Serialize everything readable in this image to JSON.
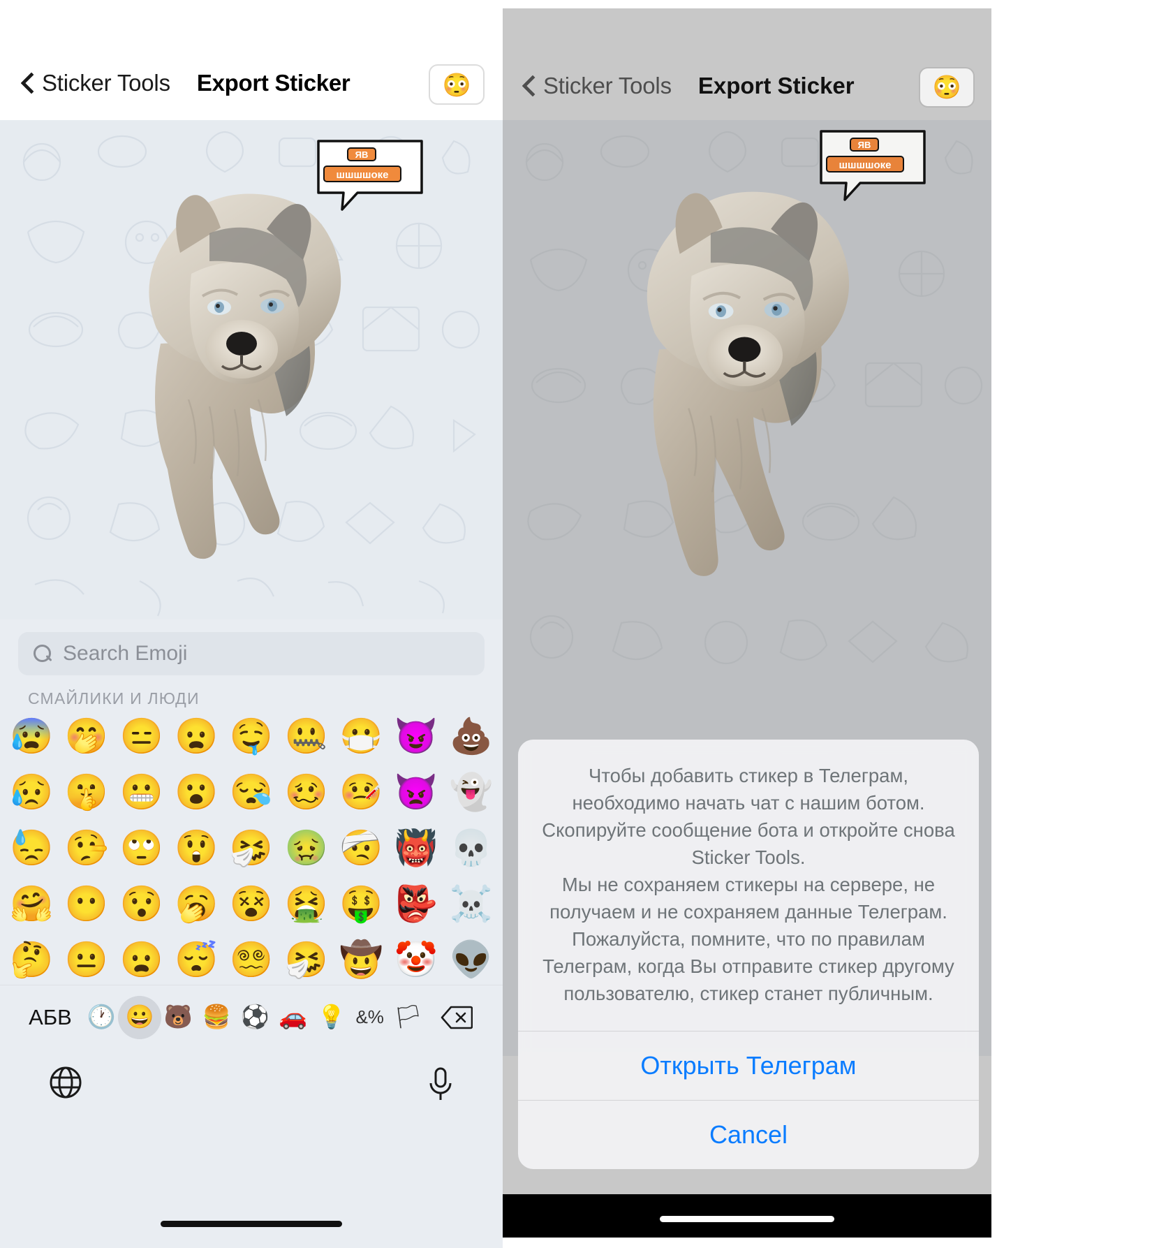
{
  "left": {
    "nav": {
      "back_label": "Sticker Tools",
      "title": "Export Sticker",
      "badge_emoji": "😳"
    },
    "sticker": {
      "bubble_line1": "ЯВ",
      "bubble_line2": "шшшшоке"
    },
    "keyboard": {
      "search_placeholder": "Search Emoji",
      "category_title": "СМАЙЛИКИ И ЛЮДИ",
      "rows": [
        [
          "😰",
          "🤭",
          "😑",
          "😦",
          "🤤",
          "🤐",
          "😷",
          "😈",
          "💩"
        ],
        [
          "😥",
          "🤫",
          "😬",
          "😮",
          "😪",
          "🥴",
          "🤒",
          "👿",
          "👻"
        ],
        [
          "😓",
          "🤥",
          "🙄",
          "😲",
          "🤧",
          "🤢",
          "🤕",
          "👹",
          "💀"
        ],
        [
          "🤗",
          "😶",
          "😯",
          "🥱",
          "😵",
          "🤮",
          "🤑",
          "👺",
          "☠️"
        ],
        [
          "🤔",
          "😐",
          "😦",
          "😴",
          "😵‍💫",
          "🤧",
          "🤠",
          "🤡",
          "👽"
        ]
      ],
      "toolbar": {
        "abc_label": "АБВ",
        "icons": [
          {
            "name": "recent-clock-icon",
            "glyph": "🕐"
          },
          {
            "name": "smileys-people-icon",
            "glyph": "😀"
          },
          {
            "name": "animals-nature-icon",
            "glyph": "🐻"
          },
          {
            "name": "food-drink-icon",
            "glyph": "🍔"
          },
          {
            "name": "activity-sports-icon",
            "glyph": "⚽"
          },
          {
            "name": "travel-places-icon",
            "glyph": "🚗"
          },
          {
            "name": "objects-icon",
            "glyph": "💡"
          },
          {
            "name": "symbols-icon",
            "glyph": "&%"
          },
          {
            "name": "flags-icon",
            "glyph": "🏳"
          }
        ],
        "selected_index": 1,
        "delete_label": "⌫"
      },
      "globe_label": "🌐",
      "mic_label": "🎤"
    }
  },
  "right": {
    "nav": {
      "back_label": "Sticker Tools",
      "title": "Export Sticker",
      "badge_emoji": "😳"
    },
    "sticker": {
      "bubble_line1": "ЯВ",
      "bubble_line2": "шшшшоке"
    },
    "alert": {
      "message": "Чтобы добавить стикер в Телеграм, необходимо начать чат с нашим ботом. Скопируйте сообщение бота и откройте снова Sticker Tools.\nМы не сохраняем стикеры на сервере, не получаем и не сохраняем данные Телеграм.  Пожалуйста, помните, что по правилам Телеграм, когда Вы отправите стикер другому пользователю, стикер станет публичным.",
      "primary_button": "Открыть Телеграм",
      "cancel_button": "Cancel"
    }
  },
  "colors": {
    "accent_blue": "#0a7cff",
    "canvas_bg": "#e6ebf0",
    "canvas_bg_dim": "#bdbfc2",
    "keyboard_bg": "#e9edf2",
    "nav_dim_bg": "#c8c8c8"
  }
}
